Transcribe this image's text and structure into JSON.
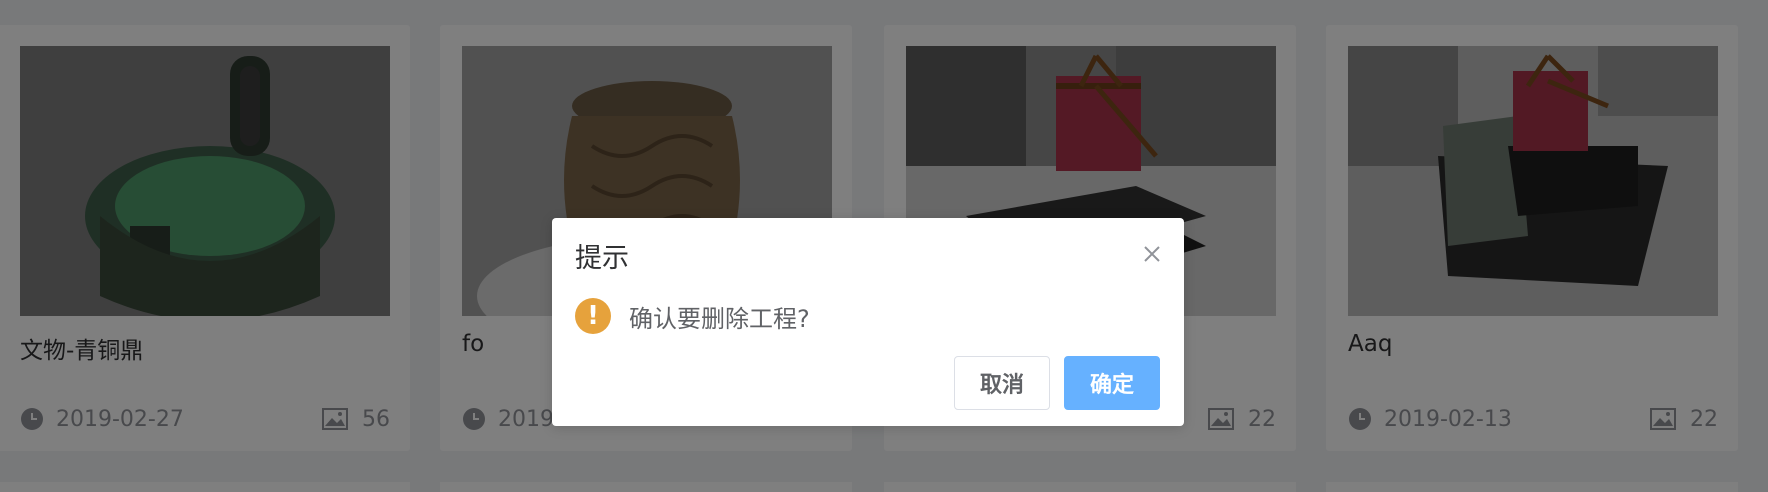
{
  "projects": [
    {
      "title": "文物-青铜鼎",
      "date": "2019-02-27",
      "count": "56"
    },
    {
      "title": "fo",
      "date": "2019",
      "count": ""
    },
    {
      "title": "",
      "date": "",
      "count": "22"
    },
    {
      "title": "Aaq",
      "date": "2019-02-13",
      "count": "22"
    }
  ],
  "dialog": {
    "title": "提示",
    "message": "确认要删除工程?",
    "cancel_label": "取消",
    "confirm_label": "确定"
  },
  "colors": {
    "warning": "#e6a23c",
    "primary": "#409eff",
    "mask": "rgba(0,0,0,0.5)"
  },
  "icons": {
    "date": "clock-icon",
    "count": "image-icon",
    "close": "close-icon",
    "warning": "warning-icon"
  }
}
